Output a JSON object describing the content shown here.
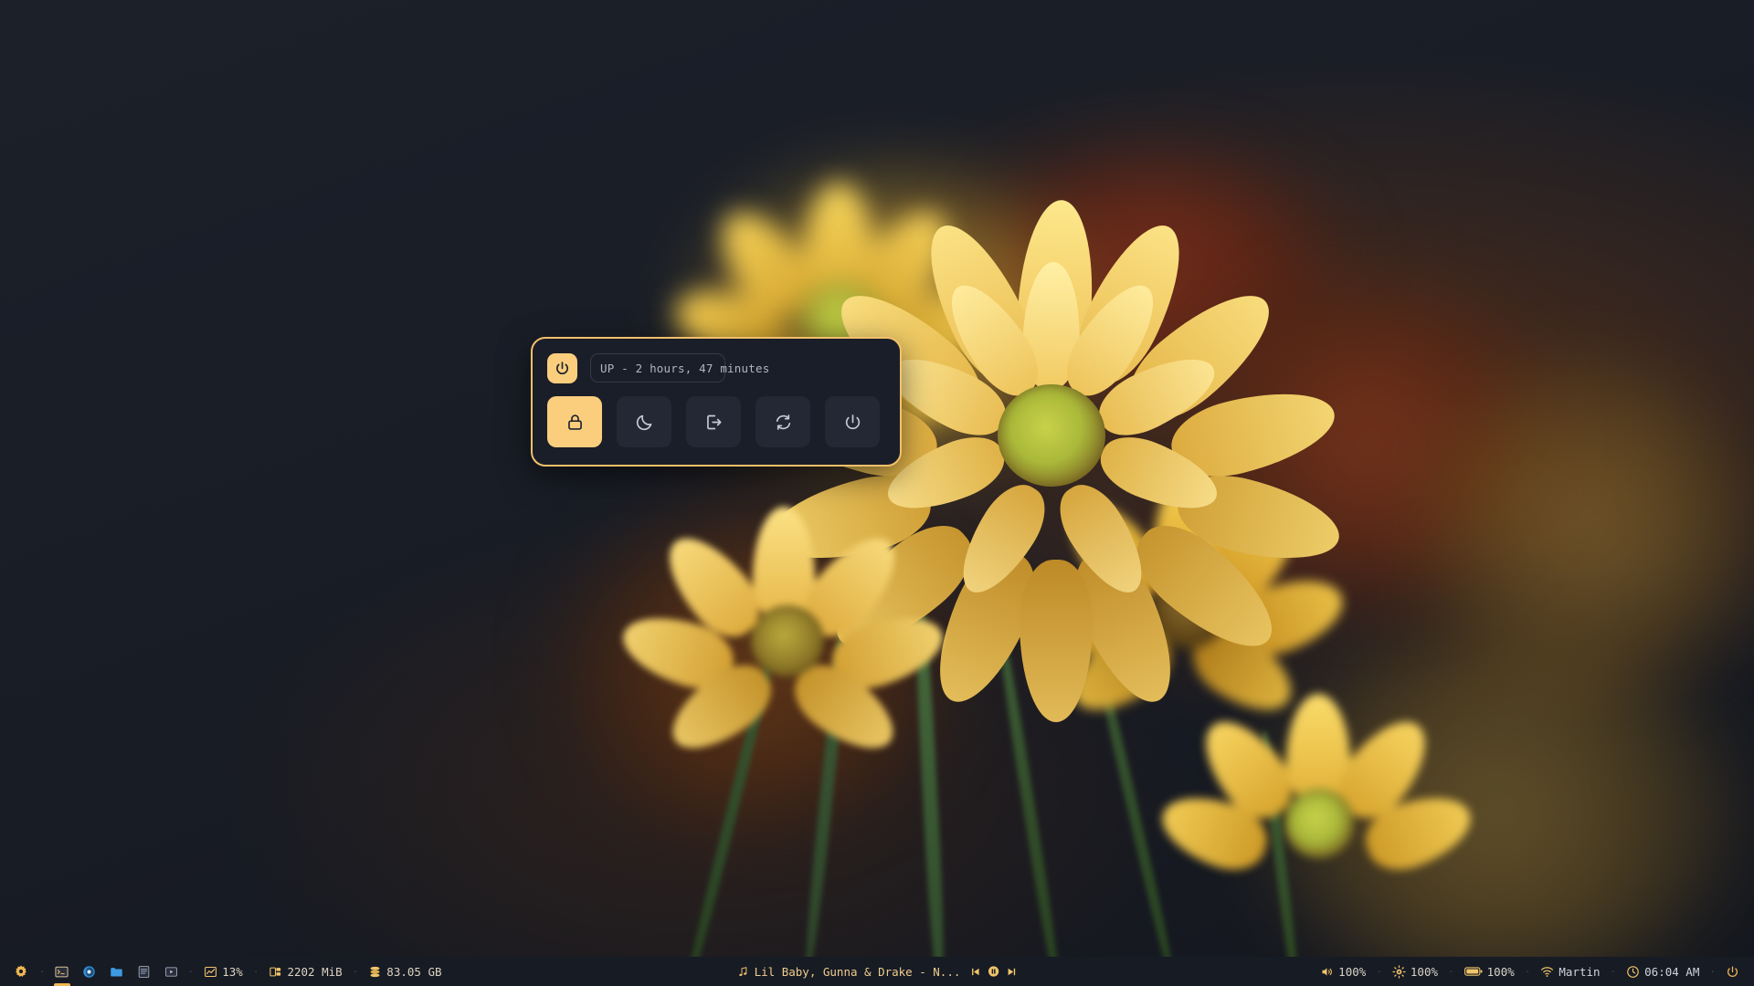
{
  "desktop": {
    "wallpaper_name": "yellow-chrysanthemum-bouquet",
    "background_color": "#171b24"
  },
  "power_dialog": {
    "uptime_label": "UP - 2 hours, 47 minutes",
    "header_icon": "power-icon",
    "accent_color": "#fbce7e",
    "border_color": "#f3c06b",
    "panel_color": "#1a1e28",
    "buttons": [
      {
        "name": "lock",
        "icon": "lock-icon",
        "label": "Lock",
        "selected": true
      },
      {
        "name": "suspend",
        "icon": "moon-icon",
        "label": "Suspend",
        "selected": false
      },
      {
        "name": "logout",
        "icon": "logout-icon",
        "label": "Log Out",
        "selected": false
      },
      {
        "name": "reboot",
        "icon": "reload-icon",
        "label": "Reboot",
        "selected": false
      },
      {
        "name": "shutdown",
        "icon": "power-icon",
        "label": "Shut Down",
        "selected": false
      }
    ]
  },
  "taskbar": {
    "background_color": "#171b24",
    "accent_color": "#f0b754",
    "app_menu": {
      "icon": "gear-icon",
      "label": ""
    },
    "separator": "·",
    "launchers": [
      {
        "name": "terminal",
        "icon": "terminal-icon",
        "color": "#e8c88a",
        "active": true
      },
      {
        "name": "web-browser",
        "icon": "browser-icon",
        "color": "#3d9ae0",
        "active": false
      },
      {
        "name": "file-manager",
        "icon": "folder-icon",
        "color": "#3d9ae0",
        "active": false
      },
      {
        "name": "text-editor",
        "icon": "document-icon",
        "color": "#8fa3bd",
        "active": false
      },
      {
        "name": "media-player",
        "icon": "media-icon",
        "color": "#8fa3bd",
        "active": false
      }
    ],
    "stats": [
      {
        "name": "cpu",
        "icon": "chart-icon",
        "value": "13%"
      },
      {
        "name": "memory",
        "icon": "memory-icon",
        "value": "2202 MiB"
      },
      {
        "name": "disk",
        "icon": "disk-icon",
        "value": "83.05 GB"
      }
    ],
    "media": {
      "note_icon": "music-note-icon",
      "title": "Lil Baby, Gunna & Drake - N...",
      "controls": [
        {
          "name": "previous",
          "icon": "skip-back-icon"
        },
        {
          "name": "pause",
          "icon": "pause-icon"
        },
        {
          "name": "next",
          "icon": "skip-forward-icon"
        }
      ]
    },
    "tray": [
      {
        "name": "volume",
        "icon": "speaker-icon",
        "value": "100%"
      },
      {
        "name": "brightness",
        "icon": "brightness-icon",
        "value": "100%"
      },
      {
        "name": "battery",
        "icon": "battery-icon",
        "value": "100%"
      }
    ],
    "network": {
      "icon": "wifi-icon",
      "ssid": "Martin"
    },
    "clock": {
      "icon": "clock-icon",
      "time": "06:04 AM"
    },
    "power_button": {
      "icon": "power-icon"
    }
  }
}
